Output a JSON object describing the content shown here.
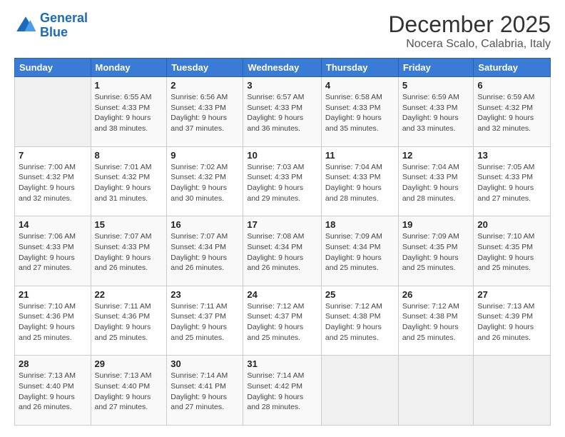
{
  "logo": {
    "line1": "General",
    "line2": "Blue"
  },
  "title": "December 2025",
  "location": "Nocera Scalo, Calabria, Italy",
  "header_days": [
    "Sunday",
    "Monday",
    "Tuesday",
    "Wednesday",
    "Thursday",
    "Friday",
    "Saturday"
  ],
  "weeks": [
    [
      {
        "day": "",
        "info": ""
      },
      {
        "day": "1",
        "info": "Sunrise: 6:55 AM\nSunset: 4:33 PM\nDaylight: 9 hours\nand 38 minutes."
      },
      {
        "day": "2",
        "info": "Sunrise: 6:56 AM\nSunset: 4:33 PM\nDaylight: 9 hours\nand 37 minutes."
      },
      {
        "day": "3",
        "info": "Sunrise: 6:57 AM\nSunset: 4:33 PM\nDaylight: 9 hours\nand 36 minutes."
      },
      {
        "day": "4",
        "info": "Sunrise: 6:58 AM\nSunset: 4:33 PM\nDaylight: 9 hours\nand 35 minutes."
      },
      {
        "day": "5",
        "info": "Sunrise: 6:59 AM\nSunset: 4:33 PM\nDaylight: 9 hours\nand 33 minutes."
      },
      {
        "day": "6",
        "info": "Sunrise: 6:59 AM\nSunset: 4:32 PM\nDaylight: 9 hours\nand 32 minutes."
      }
    ],
    [
      {
        "day": "7",
        "info": "Sunrise: 7:00 AM\nSunset: 4:32 PM\nDaylight: 9 hours\nand 32 minutes."
      },
      {
        "day": "8",
        "info": "Sunrise: 7:01 AM\nSunset: 4:32 PM\nDaylight: 9 hours\nand 31 minutes."
      },
      {
        "day": "9",
        "info": "Sunrise: 7:02 AM\nSunset: 4:32 PM\nDaylight: 9 hours\nand 30 minutes."
      },
      {
        "day": "10",
        "info": "Sunrise: 7:03 AM\nSunset: 4:33 PM\nDaylight: 9 hours\nand 29 minutes."
      },
      {
        "day": "11",
        "info": "Sunrise: 7:04 AM\nSunset: 4:33 PM\nDaylight: 9 hours\nand 28 minutes."
      },
      {
        "day": "12",
        "info": "Sunrise: 7:04 AM\nSunset: 4:33 PM\nDaylight: 9 hours\nand 28 minutes."
      },
      {
        "day": "13",
        "info": "Sunrise: 7:05 AM\nSunset: 4:33 PM\nDaylight: 9 hours\nand 27 minutes."
      }
    ],
    [
      {
        "day": "14",
        "info": "Sunrise: 7:06 AM\nSunset: 4:33 PM\nDaylight: 9 hours\nand 27 minutes."
      },
      {
        "day": "15",
        "info": "Sunrise: 7:07 AM\nSunset: 4:33 PM\nDaylight: 9 hours\nand 26 minutes."
      },
      {
        "day": "16",
        "info": "Sunrise: 7:07 AM\nSunset: 4:34 PM\nDaylight: 9 hours\nand 26 minutes."
      },
      {
        "day": "17",
        "info": "Sunrise: 7:08 AM\nSunset: 4:34 PM\nDaylight: 9 hours\nand 26 minutes."
      },
      {
        "day": "18",
        "info": "Sunrise: 7:09 AM\nSunset: 4:34 PM\nDaylight: 9 hours\nand 25 minutes."
      },
      {
        "day": "19",
        "info": "Sunrise: 7:09 AM\nSunset: 4:35 PM\nDaylight: 9 hours\nand 25 minutes."
      },
      {
        "day": "20",
        "info": "Sunrise: 7:10 AM\nSunset: 4:35 PM\nDaylight: 9 hours\nand 25 minutes."
      }
    ],
    [
      {
        "day": "21",
        "info": "Sunrise: 7:10 AM\nSunset: 4:36 PM\nDaylight: 9 hours\nand 25 minutes."
      },
      {
        "day": "22",
        "info": "Sunrise: 7:11 AM\nSunset: 4:36 PM\nDaylight: 9 hours\nand 25 minutes."
      },
      {
        "day": "23",
        "info": "Sunrise: 7:11 AM\nSunset: 4:37 PM\nDaylight: 9 hours\nand 25 minutes."
      },
      {
        "day": "24",
        "info": "Sunrise: 7:12 AM\nSunset: 4:37 PM\nDaylight: 9 hours\nand 25 minutes."
      },
      {
        "day": "25",
        "info": "Sunrise: 7:12 AM\nSunset: 4:38 PM\nDaylight: 9 hours\nand 25 minutes."
      },
      {
        "day": "26",
        "info": "Sunrise: 7:12 AM\nSunset: 4:38 PM\nDaylight: 9 hours\nand 25 minutes."
      },
      {
        "day": "27",
        "info": "Sunrise: 7:13 AM\nSunset: 4:39 PM\nDaylight: 9 hours\nand 26 minutes."
      }
    ],
    [
      {
        "day": "28",
        "info": "Sunrise: 7:13 AM\nSunset: 4:40 PM\nDaylight: 9 hours\nand 26 minutes."
      },
      {
        "day": "29",
        "info": "Sunrise: 7:13 AM\nSunset: 4:40 PM\nDaylight: 9 hours\nand 27 minutes."
      },
      {
        "day": "30",
        "info": "Sunrise: 7:14 AM\nSunset: 4:41 PM\nDaylight: 9 hours\nand 27 minutes."
      },
      {
        "day": "31",
        "info": "Sunrise: 7:14 AM\nSunset: 4:42 PM\nDaylight: 9 hours\nand 28 minutes."
      },
      {
        "day": "",
        "info": ""
      },
      {
        "day": "",
        "info": ""
      },
      {
        "day": "",
        "info": ""
      }
    ]
  ]
}
